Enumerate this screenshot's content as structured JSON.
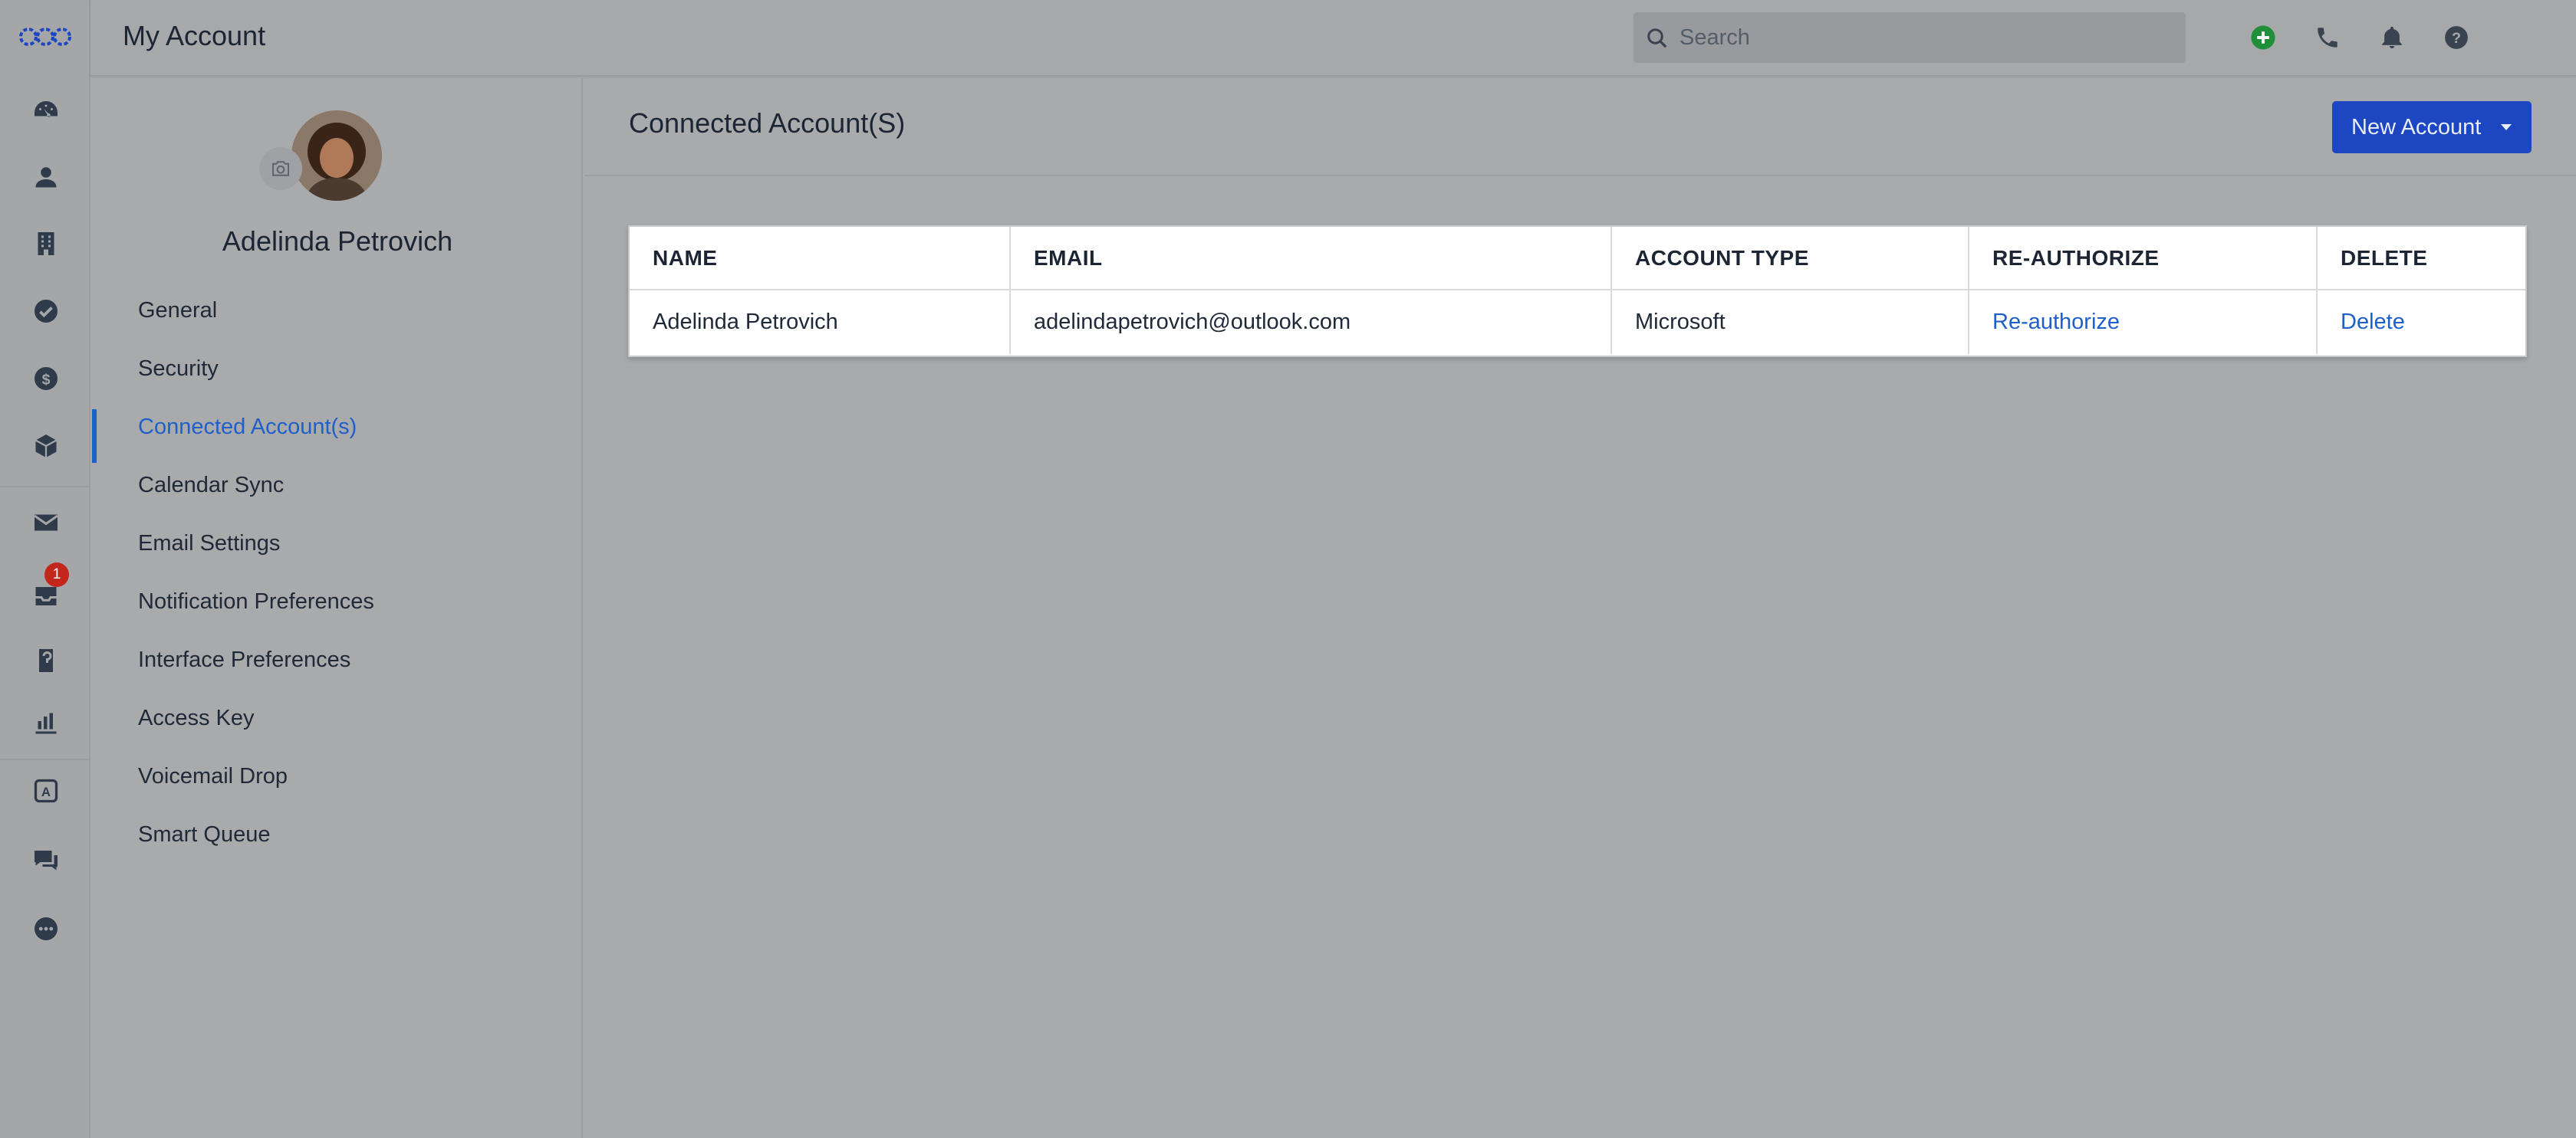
{
  "header": {
    "title": "My Account",
    "search_placeholder": "Search"
  },
  "rail": {
    "items": [
      "dashboard-icon",
      "contact-icon",
      "company-icon",
      "tasks-icon",
      "deals-icon",
      "products-icon",
      "mail-icon",
      "inbox-icon",
      "phone-log-icon",
      "reports-icon",
      "automation-icon",
      "chat-icon",
      "more-icon"
    ],
    "inbox_badge": "1"
  },
  "profile": {
    "name": "Adelinda Petrovich"
  },
  "sidebar": {
    "items": [
      {
        "label": "General",
        "active": false
      },
      {
        "label": "Security",
        "active": false
      },
      {
        "label": "Connected Account(s)",
        "active": true
      },
      {
        "label": "Calendar Sync",
        "active": false
      },
      {
        "label": "Email Settings",
        "active": false
      },
      {
        "label": "Notification Preferences",
        "active": false
      },
      {
        "label": "Interface Preferences",
        "active": false
      },
      {
        "label": "Access Key",
        "active": false
      },
      {
        "label": "Voicemail Drop",
        "active": false
      },
      {
        "label": "Smart Queue",
        "active": false
      }
    ]
  },
  "main": {
    "heading": "Connected Account(S)",
    "new_button": "New Account",
    "table": {
      "columns": [
        "NAME",
        "EMAIL",
        "ACCOUNT TYPE",
        "RE-AUTHORIZE",
        "DELETE"
      ],
      "rows": [
        {
          "name": "Adelinda Petrovich",
          "email": "adelindapetrovich@outlook.com",
          "type": "Microsoft",
          "reauth": "Re-authorize",
          "delete": "Delete"
        }
      ]
    }
  },
  "colors": {
    "accent": "#1f5fc9",
    "button": "#1d46c2",
    "badge": "#c3271c",
    "add": "#1f8f3a"
  }
}
